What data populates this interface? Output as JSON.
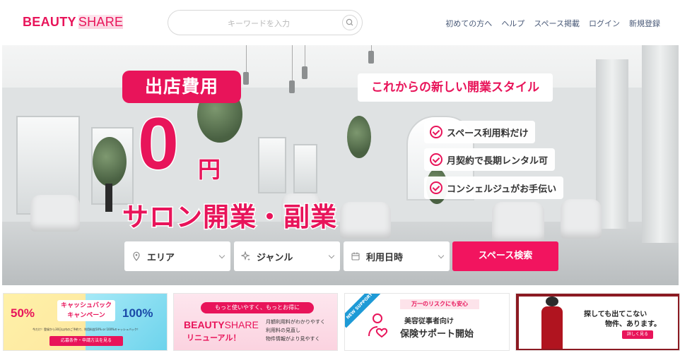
{
  "header": {
    "logo_bold": "BEAUTY",
    "logo_light": "SHARE",
    "search_placeholder": "キーワードを入力",
    "nav": [
      "初めての方へ",
      "ヘルプ",
      "スペース掲載",
      "ログイン",
      "新規登録"
    ]
  },
  "hero": {
    "tag": "出店費用",
    "zero": "0",
    "yen": "円",
    "headline": "サロン開業・副業",
    "tagline": "これからの新しい開業スタイル",
    "features": [
      "スペース利用料だけ",
      "月契約で長期レンタル可",
      "コンシェルジュがお手伝い"
    ]
  },
  "filters": {
    "area": "エリア",
    "genre": "ジャンル",
    "date": "利用日時",
    "search_button": "スペース検索"
  },
  "banners": {
    "cashback": {
      "pct1": "50%",
      "title1": "キャッシュバック",
      "title2": "キャンペーン",
      "pct2": "100%",
      "note": "今だけ！登録から30日以内のご予約で、利用料金50% or 100%キャッシュバック！",
      "button": "応募条件・申請方法を見る"
    },
    "renewal": {
      "top": "もっと使いやすく、もっとお得に",
      "brand_bold": "BEAUTY",
      "brand_light": "SHARE",
      "sub": "リニューアル！",
      "points": [
        "月額利用料がわかりやすく",
        "利用料の見直し",
        "物件情報がより見やすく"
      ]
    },
    "support": {
      "ribbon": "NEW SUPPORT",
      "top": "万一のリスクにも安心",
      "line1": "美容従事者向け",
      "line2": "保険サポート開始"
    },
    "property": {
      "headline1": "探しても出てこない",
      "headline2": "物件、あります。",
      "button": "詳しく見る"
    }
  },
  "colors": {
    "brand": "#e8145a",
    "button": "#f2145f",
    "nav_text": "#4a5a78"
  }
}
